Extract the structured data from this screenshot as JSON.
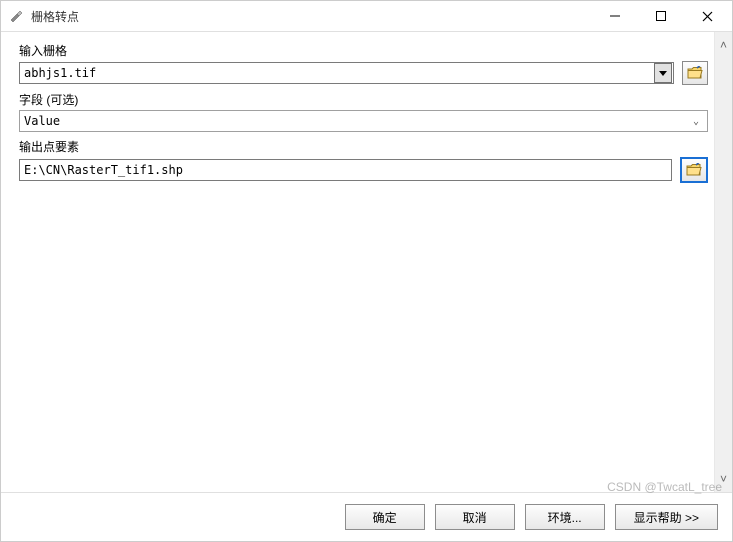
{
  "window": {
    "title": "栅格转点"
  },
  "fields": {
    "input_raster": {
      "label": "输入栅格",
      "value": "abhjs1.tif"
    },
    "field_optional": {
      "label": "字段 (可选)",
      "value": "Value"
    },
    "output_point": {
      "label": "输出点要素",
      "value": "E:\\CN\\RasterT_tif1.shp"
    }
  },
  "buttons": {
    "ok": "确定",
    "cancel": "取消",
    "env": "环境...",
    "help": "显示帮助 >>"
  },
  "watermark": "CSDN @TwcatL_tree"
}
